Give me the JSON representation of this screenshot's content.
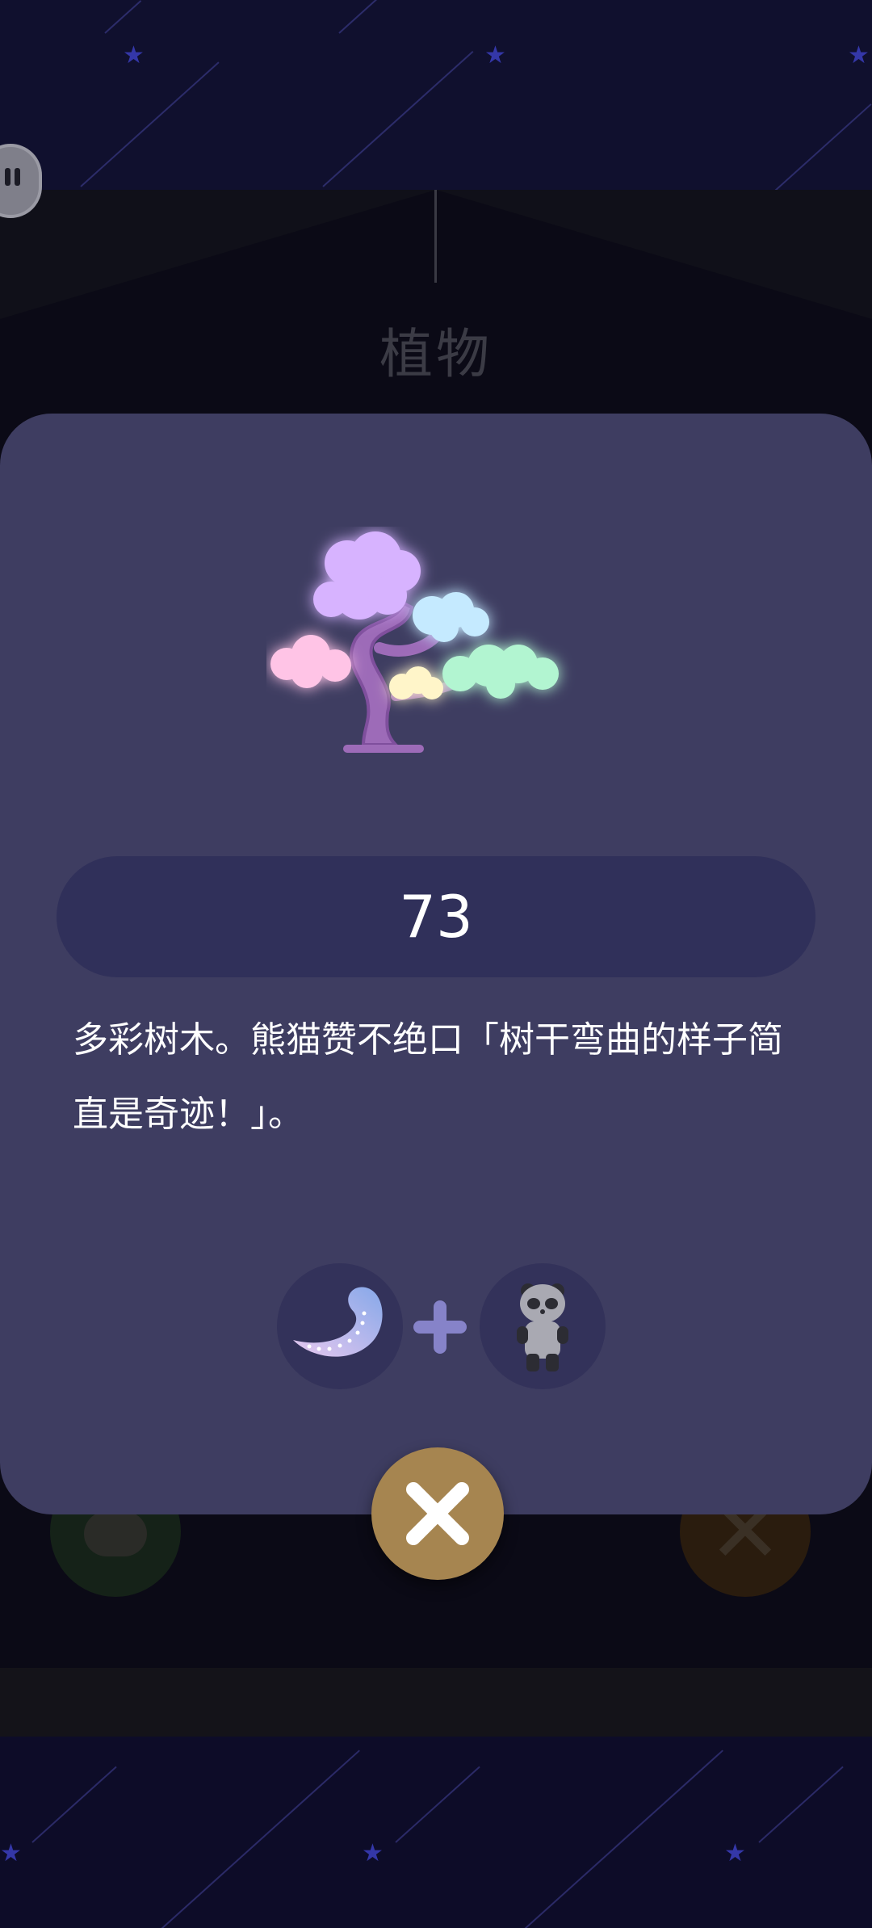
{
  "header": {
    "category_title": "植物"
  },
  "item": {
    "value": "73",
    "description": "多彩树木。熊猫赞不绝口「树干弯曲的样子简直是奇迹！」。"
  },
  "recipe": {
    "ingredients": [
      {
        "name": "comet-tail-icon"
      },
      {
        "name": "panda-icon"
      }
    ],
    "operator": "plus-icon"
  },
  "controls": {
    "close": "close-icon",
    "pause": "pause-icon"
  },
  "colors": {
    "modal_background": "#3e3d61",
    "pill_background": "#30305a",
    "close_button": "#a68550",
    "plus_sign": "#8683c9",
    "star": "#3437a8"
  }
}
